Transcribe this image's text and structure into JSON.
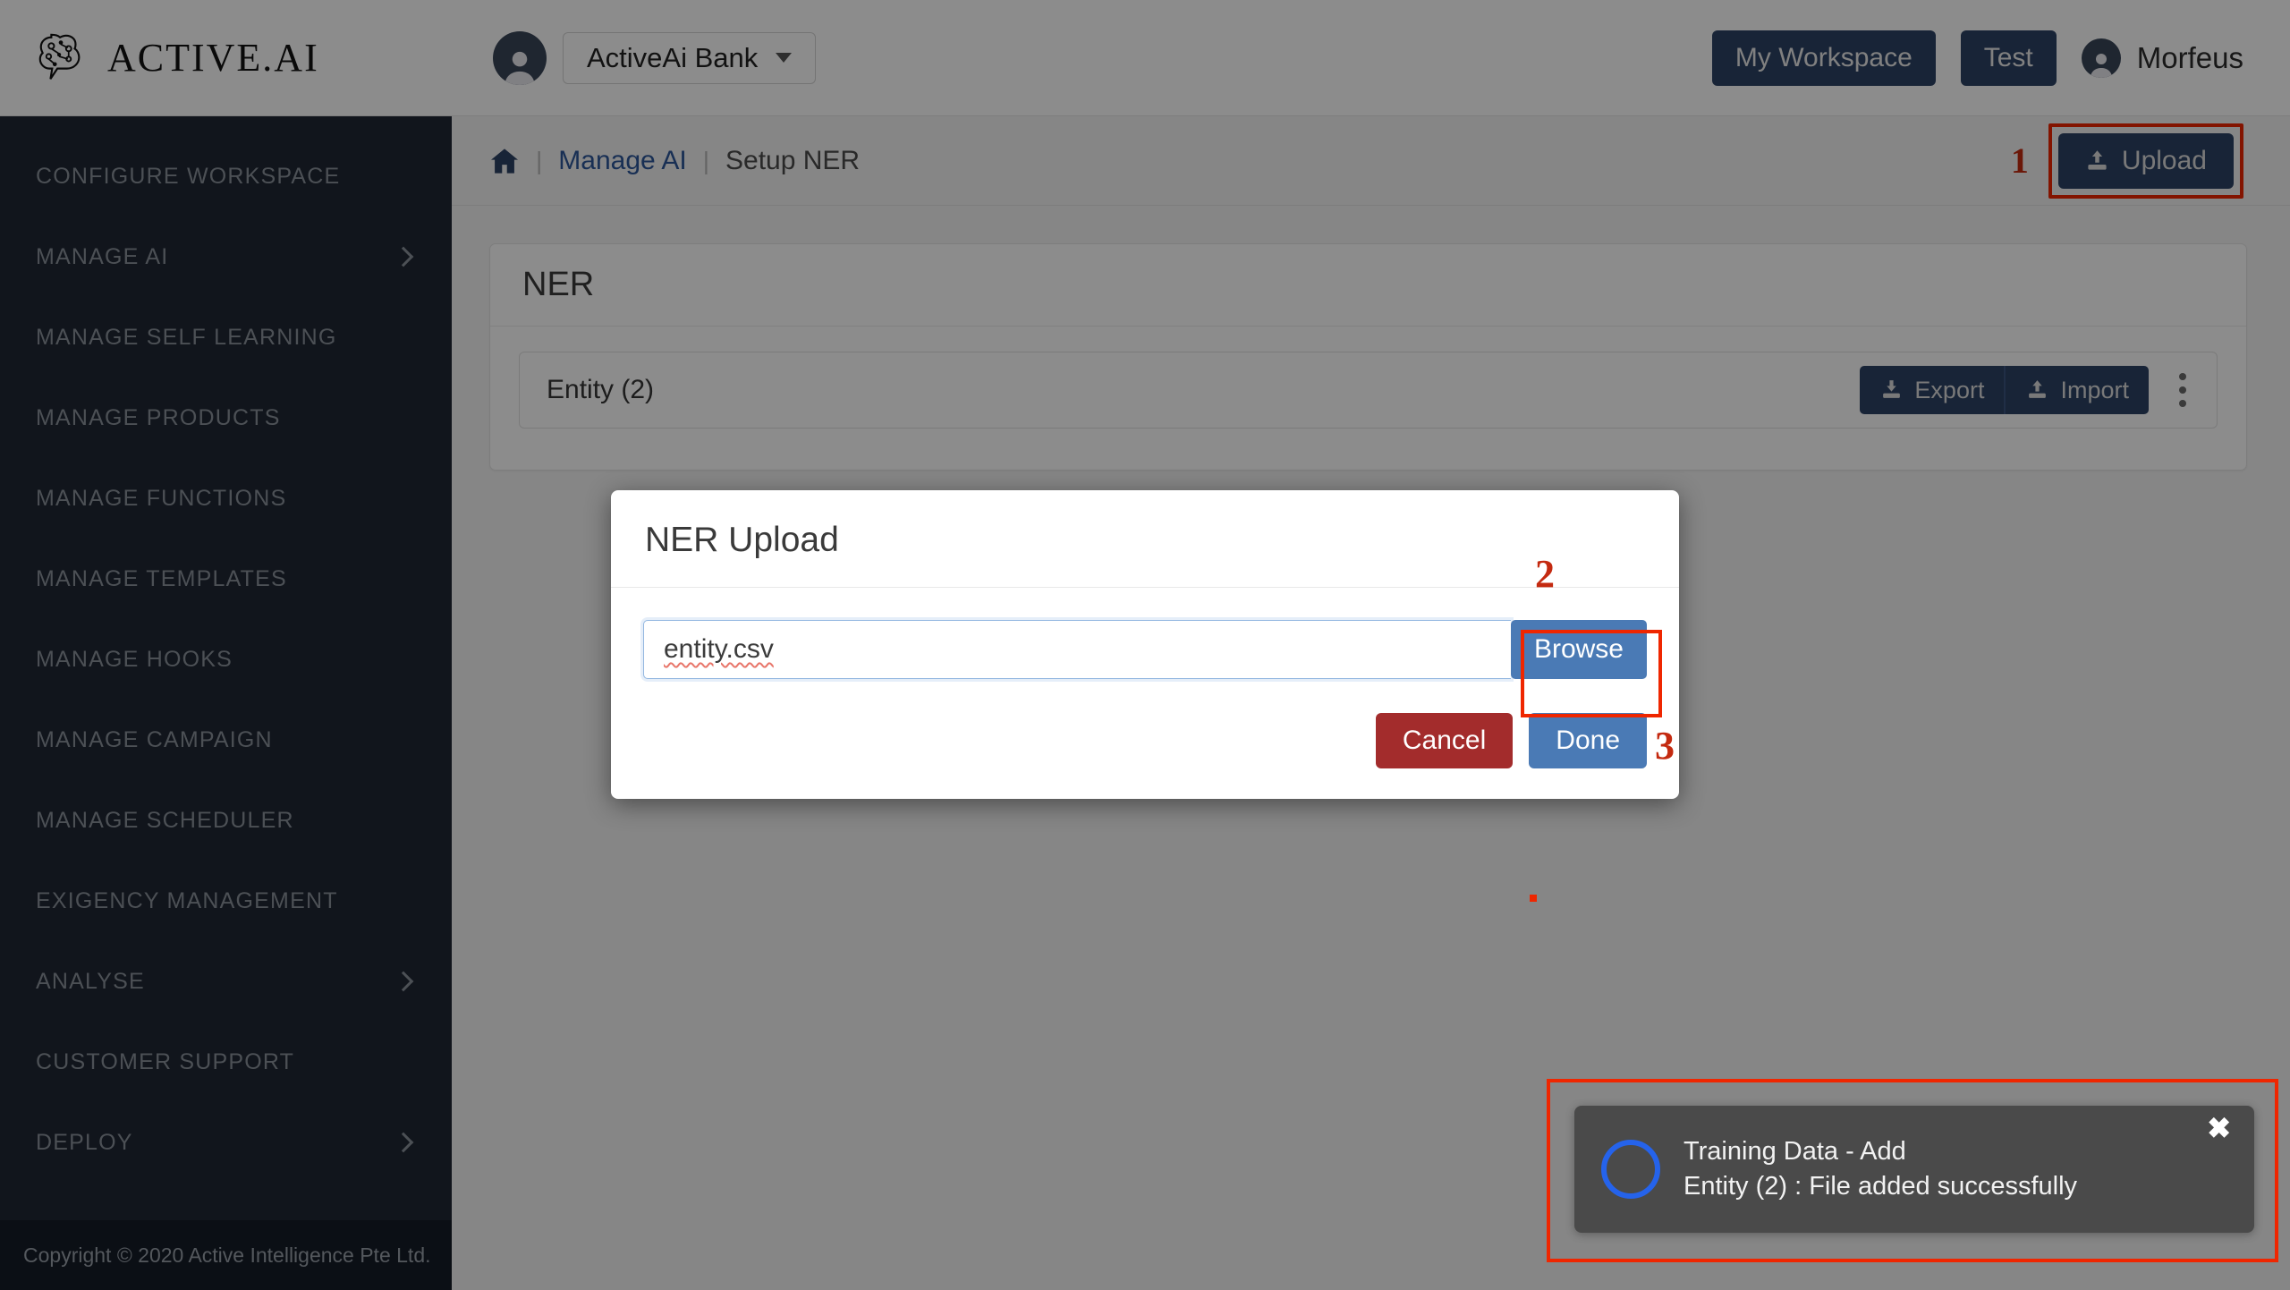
{
  "brand": {
    "name": "ACTIVE.AI",
    "logo_icon": "brain-network-icon"
  },
  "header": {
    "workspace_avatar_icon": "user-avatar-icon",
    "bank_name": "ActiveAi Bank",
    "bank_caret_icon": "caret-down-icon",
    "my_workspace_label": "My Workspace",
    "test_label": "Test",
    "user_avatar_icon": "user-avatar-icon",
    "user_name": "Morfeus"
  },
  "sidebar": {
    "items": [
      {
        "label": "CONFIGURE WORKSPACE",
        "expandable": false
      },
      {
        "label": "MANAGE AI",
        "expandable": true
      },
      {
        "label": "MANAGE SELF LEARNING",
        "expandable": false
      },
      {
        "label": "MANAGE PRODUCTS",
        "expandable": false
      },
      {
        "label": "MANAGE FUNCTIONS",
        "expandable": false
      },
      {
        "label": "MANAGE TEMPLATES",
        "expandable": false
      },
      {
        "label": "MANAGE HOOKS",
        "expandable": false
      },
      {
        "label": "MANAGE CAMPAIGN",
        "expandable": false
      },
      {
        "label": "MANAGE SCHEDULER",
        "expandable": false
      },
      {
        "label": "EXIGENCY MANAGEMENT",
        "expandable": false
      },
      {
        "label": "ANALYSE",
        "expandable": true
      },
      {
        "label": "CUSTOMER SUPPORT",
        "expandable": false
      },
      {
        "label": "DEPLOY",
        "expandable": true
      }
    ],
    "footer": "Copyright © 2020 Active Intelligence Pte Ltd."
  },
  "breadcrumb": {
    "home_icon": "home-icon",
    "sep": "|",
    "link": "Manage AI",
    "current": "Setup NER"
  },
  "toolbar": {
    "step_number": "1",
    "upload_label": "Upload",
    "upload_icon": "upload-icon"
  },
  "main": {
    "card_title": "NER",
    "entity": {
      "name": "Entity (2)",
      "export_label": "Export",
      "export_icon": "download-icon",
      "import_label": "Import",
      "import_icon": "upload-icon",
      "kebab_icon": "more-vertical-icon"
    }
  },
  "modal": {
    "title": "NER Upload",
    "file_value": "entity.csv",
    "file_placeholder": "",
    "browse_label": "Browse",
    "browse_step_number": "2",
    "cancel_label": "Cancel",
    "done_label": "Done",
    "done_step_number": "3"
  },
  "toast": {
    "title": "Training Data - Add",
    "message": "Entity (2) : File added successfully",
    "close_icon": "close-icon",
    "spinner_icon": "loading-spinner-icon"
  },
  "colors": {
    "navy": "#2c4265",
    "sidebar": "#1f2733",
    "accent_blue": "#4a7ab5",
    "danger_red": "#a32c2c",
    "annotation_red": "#ef2600",
    "toast_bg": "#4a4a4a"
  }
}
